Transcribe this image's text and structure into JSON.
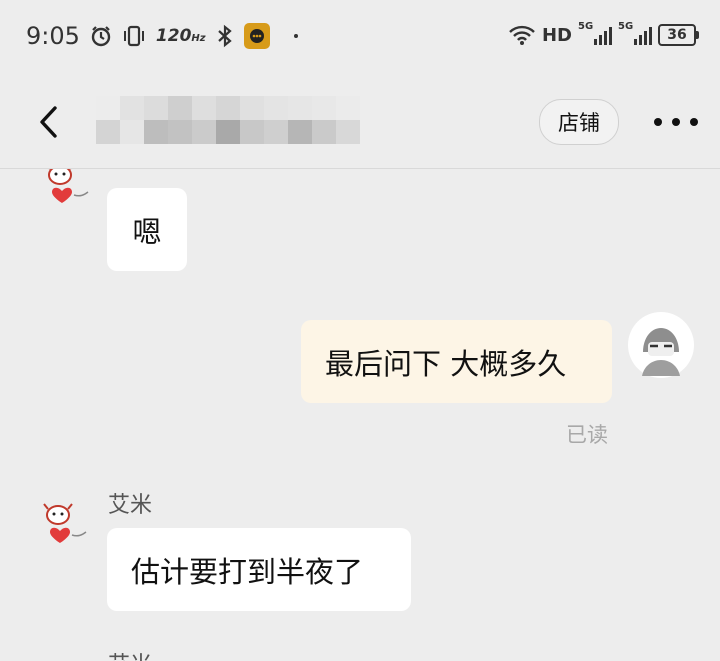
{
  "status_bar": {
    "time": "9:05",
    "refresh_rate": "120",
    "refresh_unit": "Hz",
    "hd_label": "HD",
    "network_1": "5G",
    "network_2": "5G",
    "battery": "36"
  },
  "nav": {
    "shop_label": "店铺"
  },
  "messages": [
    {
      "side": "left",
      "text": "嗯"
    },
    {
      "side": "right",
      "text": "最后问下 大概多久",
      "status": "已读"
    },
    {
      "side": "left",
      "sender": "艾米",
      "text": "估计要打到半夜了"
    },
    {
      "side": "left",
      "sender": "艾米"
    }
  ],
  "colors": {
    "background": "#ededed",
    "my_bubble": "#fdf5e6",
    "their_bubble": "#ffffff",
    "read_text": "#a8a8a8"
  },
  "icons": [
    "alarm-icon",
    "vibrate-icon",
    "bluetooth-icon",
    "app-notification-icon",
    "wifi-icon",
    "signal-icon",
    "battery-icon",
    "back-icon",
    "more-icon",
    "cow-avatar-icon",
    "user-avatar-icon"
  ]
}
